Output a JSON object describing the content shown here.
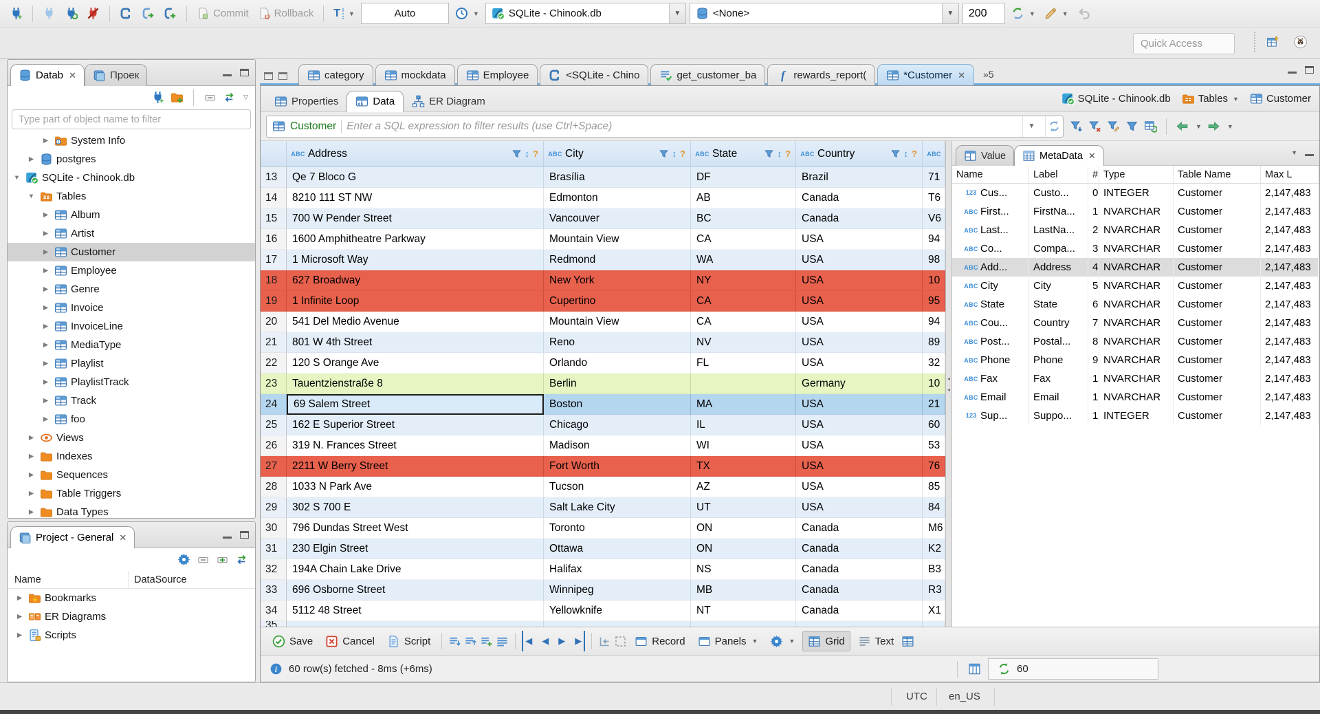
{
  "toolbar": {
    "commit": "Commit",
    "rollback": "Rollback",
    "auto": "Auto",
    "datasource": "SQLite - Chinook.db",
    "schema": "<None>",
    "fetch_size": "200",
    "quick_access": "Quick Access"
  },
  "left_panel": {
    "tabs": [
      {
        "label": "Datab",
        "closable": true,
        "icon": "database",
        "active": true
      },
      {
        "label": "Проек",
        "icon": "window"
      }
    ],
    "filter_placeholder": "Type part of object name to filter",
    "tree": [
      {
        "label": "System Info",
        "icon": "folder-info",
        "depth": 2,
        "state": "collapsed"
      },
      {
        "label": "postgres",
        "icon": "database",
        "depth": 1,
        "state": "collapsed"
      },
      {
        "label": "SQLite - Chinook.db",
        "icon": "sqlite-db",
        "depth": 0,
        "state": "expanded"
      },
      {
        "label": "Tables",
        "icon": "folder-tables",
        "depth": 1,
        "state": "expanded"
      },
      {
        "label": "Album",
        "icon": "table",
        "depth": 2,
        "state": "collapsed"
      },
      {
        "label": "Artist",
        "icon": "table",
        "depth": 2,
        "state": "collapsed"
      },
      {
        "label": "Customer",
        "icon": "table",
        "depth": 2,
        "state": "collapsed",
        "selected": true
      },
      {
        "label": "Employee",
        "icon": "table",
        "depth": 2,
        "state": "collapsed"
      },
      {
        "label": "Genre",
        "icon": "table",
        "depth": 2,
        "state": "collapsed"
      },
      {
        "label": "Invoice",
        "icon": "table",
        "depth": 2,
        "state": "collapsed"
      },
      {
        "label": "InvoiceLine",
        "icon": "table",
        "depth": 2,
        "state": "collapsed"
      },
      {
        "label": "MediaType",
        "icon": "table",
        "depth": 2,
        "state": "collapsed"
      },
      {
        "label": "Playlist",
        "icon": "table",
        "depth": 2,
        "state": "collapsed"
      },
      {
        "label": "PlaylistTrack",
        "icon": "table",
        "depth": 2,
        "state": "collapsed"
      },
      {
        "label": "Track",
        "icon": "table",
        "depth": 2,
        "state": "collapsed"
      },
      {
        "label": "foo",
        "icon": "table",
        "depth": 2,
        "state": "collapsed"
      },
      {
        "label": "Views",
        "icon": "eye",
        "depth": 1,
        "state": "collapsed"
      },
      {
        "label": "Indexes",
        "icon": "folder",
        "depth": 1,
        "state": "collapsed"
      },
      {
        "label": "Sequences",
        "icon": "folder",
        "depth": 1,
        "state": "collapsed"
      },
      {
        "label": "Table Triggers",
        "icon": "folder",
        "depth": 1,
        "state": "collapsed"
      },
      {
        "label": "Data Types",
        "icon": "folder",
        "depth": 1,
        "state": "collapsed"
      }
    ]
  },
  "project_panel": {
    "title": "Project - General",
    "columns": [
      "Name",
      "DataSource"
    ],
    "items": [
      {
        "label": "Bookmarks",
        "icon": "folder-star"
      },
      {
        "label": "ER Diagrams",
        "icon": "erd"
      },
      {
        "label": "Scripts",
        "icon": "script"
      }
    ]
  },
  "editor_tabs": {
    "tabs": [
      {
        "label": "category",
        "icon": "table"
      },
      {
        "label": "mockdata",
        "icon": "table"
      },
      {
        "label": "Employee",
        "icon": "table"
      },
      {
        "label": "<SQLite - Chino",
        "icon": "sql"
      },
      {
        "label": "get_customer_ba",
        "icon": "script-check"
      },
      {
        "label": "rewards_report(",
        "icon": "function"
      },
      {
        "label": "*Customer",
        "icon": "table",
        "active": true,
        "closable": true
      }
    ],
    "overflow": "»5"
  },
  "result_tabs": [
    {
      "label": "Properties",
      "icon": "table"
    },
    {
      "label": "Data",
      "icon": "table-data",
      "active": true
    },
    {
      "label": "ER Diagram",
      "icon": "diagram"
    }
  ],
  "context": {
    "datasource": "SQLite - Chinook.db",
    "container": "Tables",
    "entity": "Customer"
  },
  "filter_bar": {
    "entity": "Customer",
    "placeholder": "Enter a SQL expression to filter results (use Ctrl+Space)"
  },
  "grid": {
    "columns": [
      "Address",
      "City",
      "State",
      "Country"
    ],
    "rows": [
      {
        "num": "13",
        "cells": [
          "Qe 7 Bloco G",
          "Brasília",
          "DF",
          "Brazil",
          "71"
        ],
        "style": "blue"
      },
      {
        "num": "14",
        "cells": [
          "8210 111 ST NW",
          "Edmonton",
          "AB",
          "Canada",
          "T6"
        ],
        "style": "white"
      },
      {
        "num": "15",
        "cells": [
          "700 W Pender Street",
          "Vancouver",
          "BC",
          "Canada",
          "V6"
        ],
        "style": "blue"
      },
      {
        "num": "16",
        "cells": [
          "1600 Amphitheatre Parkway",
          "Mountain View",
          "CA",
          "USA",
          "94"
        ],
        "style": "white"
      },
      {
        "num": "17",
        "cells": [
          "1 Microsoft Way",
          "Redmond",
          "WA",
          "USA",
          "98"
        ],
        "style": "blue"
      },
      {
        "num": "18",
        "cells": [
          "627 Broadway",
          "New York",
          "NY",
          "USA",
          "10"
        ],
        "style": "red"
      },
      {
        "num": "19",
        "cells": [
          "1 Infinite Loop",
          "Cupertino",
          "CA",
          "USA",
          "95"
        ],
        "style": "red"
      },
      {
        "num": "20",
        "cells": [
          "541 Del Medio Avenue",
          "Mountain View",
          "CA",
          "USA",
          "94"
        ],
        "style": "white"
      },
      {
        "num": "21",
        "cells": [
          "801 W 4th Street",
          "Reno",
          "NV",
          "USA",
          "89"
        ],
        "style": "blue"
      },
      {
        "num": "22",
        "cells": [
          "120 S Orange Ave",
          "Orlando",
          "FL",
          "USA",
          "32"
        ],
        "style": "white"
      },
      {
        "num": "23",
        "cells": [
          "Tauentzienstraße 8",
          "Berlin",
          "",
          "Germany",
          "10"
        ],
        "style": "green"
      },
      {
        "num": "24",
        "cells": [
          "69 Salem Street",
          "Boston",
          "MA",
          "USA",
          "21"
        ],
        "style": "sel",
        "focused_cell": 0
      },
      {
        "num": "25",
        "cells": [
          "162 E Superior Street",
          "Chicago",
          "IL",
          "USA",
          "60"
        ],
        "style": "blue"
      },
      {
        "num": "26",
        "cells": [
          "319 N. Frances Street",
          "Madison",
          "WI",
          "USA",
          "53"
        ],
        "style": "white"
      },
      {
        "num": "27",
        "cells": [
          "2211 W Berry Street",
          "Fort Worth",
          "TX",
          "USA",
          "76"
        ],
        "style": "red"
      },
      {
        "num": "28",
        "cells": [
          "1033 N Park Ave",
          "Tucson",
          "AZ",
          "USA",
          "85"
        ],
        "style": "white"
      },
      {
        "num": "29",
        "cells": [
          "302 S 700 E",
          "Salt Lake City",
          "UT",
          "USA",
          "84"
        ],
        "style": "blue"
      },
      {
        "num": "30",
        "cells": [
          "796 Dundas Street West",
          "Toronto",
          "ON",
          "Canada",
          "M6"
        ],
        "style": "white"
      },
      {
        "num": "31",
        "cells": [
          "230 Elgin Street",
          "Ottawa",
          "ON",
          "Canada",
          "K2"
        ],
        "style": "blue"
      },
      {
        "num": "32",
        "cells": [
          "194A Chain Lake Drive",
          "Halifax",
          "NS",
          "Canada",
          "B3"
        ],
        "style": "white"
      },
      {
        "num": "33",
        "cells": [
          "696 Osborne Street",
          "Winnipeg",
          "MB",
          "Canada",
          "R3"
        ],
        "style": "blue"
      },
      {
        "num": "34",
        "cells": [
          "5112 48 Street",
          "Yellowknife",
          "NT",
          "Canada",
          "X1"
        ],
        "style": "white"
      },
      {
        "num": "35",
        "cells": [
          "",
          "",
          "",
          "",
          ""
        ],
        "style": "blue",
        "partial": true
      }
    ]
  },
  "metadata_panel": {
    "tabs": [
      {
        "label": "Value",
        "icon": "panel-value"
      },
      {
        "label": "MetaData",
        "icon": "panel-grid",
        "active": true,
        "closable": true
      }
    ],
    "columns": [
      "Name",
      "Label",
      "#",
      "Type",
      "Table Name",
      "Max L"
    ],
    "rows": [
      {
        "icon": "123",
        "name": "Cus...",
        "label": "Custo...",
        "num": "0",
        "type": "INTEGER",
        "table": "Customer",
        "max": "2,147,483"
      },
      {
        "icon": "abc",
        "name": "First...",
        "label": "FirstNa...",
        "num": "1",
        "type": "NVARCHAR",
        "table": "Customer",
        "max": "2,147,483"
      },
      {
        "icon": "abc",
        "name": "Last...",
        "label": "LastNa...",
        "num": "2",
        "type": "NVARCHAR",
        "table": "Customer",
        "max": "2,147,483"
      },
      {
        "icon": "abc",
        "name": "Co...",
        "label": "Compa...",
        "num": "3",
        "type": "NVARCHAR",
        "table": "Customer",
        "max": "2,147,483"
      },
      {
        "icon": "abc",
        "name": "Add...",
        "label": "Address",
        "num": "4",
        "type": "NVARCHAR",
        "table": "Customer",
        "max": "2,147,483",
        "selected": true
      },
      {
        "icon": "abc",
        "name": "City",
        "label": "City",
        "num": "5",
        "type": "NVARCHAR",
        "table": "Customer",
        "max": "2,147,483"
      },
      {
        "icon": "abc",
        "name": "State",
        "label": "State",
        "num": "6",
        "type": "NVARCHAR",
        "table": "Customer",
        "max": "2,147,483"
      },
      {
        "icon": "abc",
        "name": "Cou...",
        "label": "Country",
        "num": "7",
        "type": "NVARCHAR",
        "table": "Customer",
        "max": "2,147,483"
      },
      {
        "icon": "abc",
        "name": "Post...",
        "label": "Postal...",
        "num": "8",
        "type": "NVARCHAR",
        "table": "Customer",
        "max": "2,147,483"
      },
      {
        "icon": "abc",
        "name": "Phone",
        "label": "Phone",
        "num": "9",
        "type": "NVARCHAR",
        "table": "Customer",
        "max": "2,147,483"
      },
      {
        "icon": "abc",
        "name": "Fax",
        "label": "Fax",
        "num": "1",
        "type": "NVARCHAR",
        "table": "Customer",
        "max": "2,147,483"
      },
      {
        "icon": "abc",
        "name": "Email",
        "label": "Email",
        "num": "1",
        "type": "NVARCHAR",
        "table": "Customer",
        "max": "2,147,483"
      },
      {
        "icon": "123",
        "name": "Sup...",
        "label": "Suppo...",
        "num": "1",
        "type": "INTEGER",
        "table": "Customer",
        "max": "2,147,483"
      }
    ]
  },
  "result_toolbar": {
    "save": "Save",
    "cancel": "Cancel",
    "script": "Script",
    "record": "Record",
    "panels": "Panels",
    "grid": "Grid",
    "text": "Text"
  },
  "status": {
    "message": "60 row(s) fetched - 8ms (+6ms)",
    "refresh_count": "60"
  },
  "window": {
    "timezone": "UTC",
    "locale": "en_US"
  }
}
